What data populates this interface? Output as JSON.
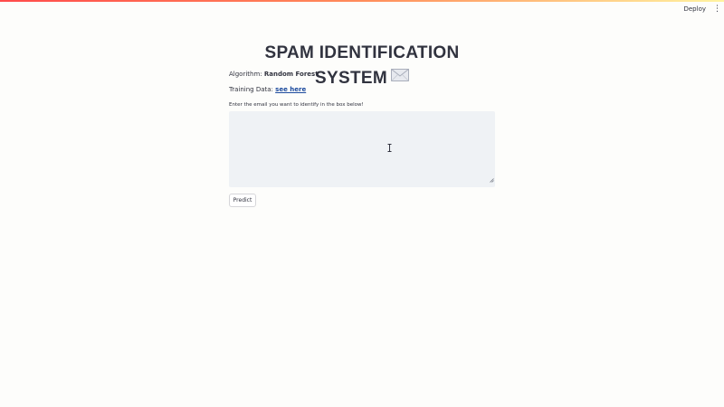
{
  "header": {
    "deploy_label": "Deploy",
    "menu_icon": "⋮"
  },
  "main": {
    "title": "SPAM IDENTIFICATION SYSTEM",
    "title_icon": "envelope-icon",
    "algorithm_label": "Algorithm:",
    "algorithm_value": "Random Forest",
    "training_label": "Training Data:",
    "training_link": "see here",
    "prompt": "Enter the email you want to identify in the box below!",
    "textarea_value": "",
    "predict_label": "Predict"
  },
  "colors": {
    "accent_bar_start": "#ff4b4b",
    "accent_bar_end": "#fff3a0",
    "link": "#1d4b9e",
    "textarea_bg": "#eff2f5"
  }
}
